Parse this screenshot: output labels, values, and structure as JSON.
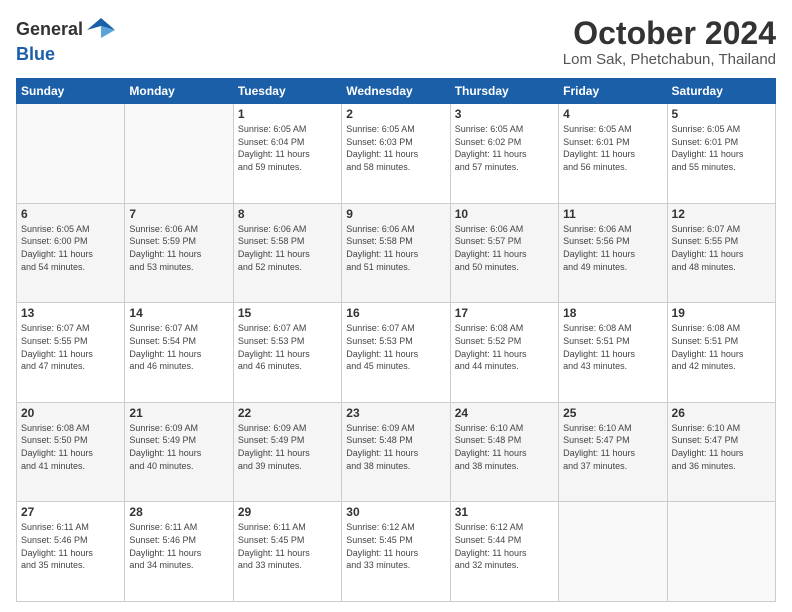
{
  "logo": {
    "general": "General",
    "blue": "Blue"
  },
  "header": {
    "month": "October 2024",
    "location": "Lom Sak, Phetchabun, Thailand"
  },
  "days_of_week": [
    "Sunday",
    "Monday",
    "Tuesday",
    "Wednesday",
    "Thursday",
    "Friday",
    "Saturday"
  ],
  "weeks": [
    [
      {
        "day": "",
        "info": ""
      },
      {
        "day": "",
        "info": ""
      },
      {
        "day": "1",
        "info": "Sunrise: 6:05 AM\nSunset: 6:04 PM\nDaylight: 11 hours\nand 59 minutes."
      },
      {
        "day": "2",
        "info": "Sunrise: 6:05 AM\nSunset: 6:03 PM\nDaylight: 11 hours\nand 58 minutes."
      },
      {
        "day": "3",
        "info": "Sunrise: 6:05 AM\nSunset: 6:02 PM\nDaylight: 11 hours\nand 57 minutes."
      },
      {
        "day": "4",
        "info": "Sunrise: 6:05 AM\nSunset: 6:01 PM\nDaylight: 11 hours\nand 56 minutes."
      },
      {
        "day": "5",
        "info": "Sunrise: 6:05 AM\nSunset: 6:01 PM\nDaylight: 11 hours\nand 55 minutes."
      }
    ],
    [
      {
        "day": "6",
        "info": "Sunrise: 6:05 AM\nSunset: 6:00 PM\nDaylight: 11 hours\nand 54 minutes."
      },
      {
        "day": "7",
        "info": "Sunrise: 6:06 AM\nSunset: 5:59 PM\nDaylight: 11 hours\nand 53 minutes."
      },
      {
        "day": "8",
        "info": "Sunrise: 6:06 AM\nSunset: 5:58 PM\nDaylight: 11 hours\nand 52 minutes."
      },
      {
        "day": "9",
        "info": "Sunrise: 6:06 AM\nSunset: 5:58 PM\nDaylight: 11 hours\nand 51 minutes."
      },
      {
        "day": "10",
        "info": "Sunrise: 6:06 AM\nSunset: 5:57 PM\nDaylight: 11 hours\nand 50 minutes."
      },
      {
        "day": "11",
        "info": "Sunrise: 6:06 AM\nSunset: 5:56 PM\nDaylight: 11 hours\nand 49 minutes."
      },
      {
        "day": "12",
        "info": "Sunrise: 6:07 AM\nSunset: 5:55 PM\nDaylight: 11 hours\nand 48 minutes."
      }
    ],
    [
      {
        "day": "13",
        "info": "Sunrise: 6:07 AM\nSunset: 5:55 PM\nDaylight: 11 hours\nand 47 minutes."
      },
      {
        "day": "14",
        "info": "Sunrise: 6:07 AM\nSunset: 5:54 PM\nDaylight: 11 hours\nand 46 minutes."
      },
      {
        "day": "15",
        "info": "Sunrise: 6:07 AM\nSunset: 5:53 PM\nDaylight: 11 hours\nand 46 minutes."
      },
      {
        "day": "16",
        "info": "Sunrise: 6:07 AM\nSunset: 5:53 PM\nDaylight: 11 hours\nand 45 minutes."
      },
      {
        "day": "17",
        "info": "Sunrise: 6:08 AM\nSunset: 5:52 PM\nDaylight: 11 hours\nand 44 minutes."
      },
      {
        "day": "18",
        "info": "Sunrise: 6:08 AM\nSunset: 5:51 PM\nDaylight: 11 hours\nand 43 minutes."
      },
      {
        "day": "19",
        "info": "Sunrise: 6:08 AM\nSunset: 5:51 PM\nDaylight: 11 hours\nand 42 minutes."
      }
    ],
    [
      {
        "day": "20",
        "info": "Sunrise: 6:08 AM\nSunset: 5:50 PM\nDaylight: 11 hours\nand 41 minutes."
      },
      {
        "day": "21",
        "info": "Sunrise: 6:09 AM\nSunset: 5:49 PM\nDaylight: 11 hours\nand 40 minutes."
      },
      {
        "day": "22",
        "info": "Sunrise: 6:09 AM\nSunset: 5:49 PM\nDaylight: 11 hours\nand 39 minutes."
      },
      {
        "day": "23",
        "info": "Sunrise: 6:09 AM\nSunset: 5:48 PM\nDaylight: 11 hours\nand 38 minutes."
      },
      {
        "day": "24",
        "info": "Sunrise: 6:10 AM\nSunset: 5:48 PM\nDaylight: 11 hours\nand 38 minutes."
      },
      {
        "day": "25",
        "info": "Sunrise: 6:10 AM\nSunset: 5:47 PM\nDaylight: 11 hours\nand 37 minutes."
      },
      {
        "day": "26",
        "info": "Sunrise: 6:10 AM\nSunset: 5:47 PM\nDaylight: 11 hours\nand 36 minutes."
      }
    ],
    [
      {
        "day": "27",
        "info": "Sunrise: 6:11 AM\nSunset: 5:46 PM\nDaylight: 11 hours\nand 35 minutes."
      },
      {
        "day": "28",
        "info": "Sunrise: 6:11 AM\nSunset: 5:46 PM\nDaylight: 11 hours\nand 34 minutes."
      },
      {
        "day": "29",
        "info": "Sunrise: 6:11 AM\nSunset: 5:45 PM\nDaylight: 11 hours\nand 33 minutes."
      },
      {
        "day": "30",
        "info": "Sunrise: 6:12 AM\nSunset: 5:45 PM\nDaylight: 11 hours\nand 33 minutes."
      },
      {
        "day": "31",
        "info": "Sunrise: 6:12 AM\nSunset: 5:44 PM\nDaylight: 11 hours\nand 32 minutes."
      },
      {
        "day": "",
        "info": ""
      },
      {
        "day": "",
        "info": ""
      }
    ]
  ]
}
